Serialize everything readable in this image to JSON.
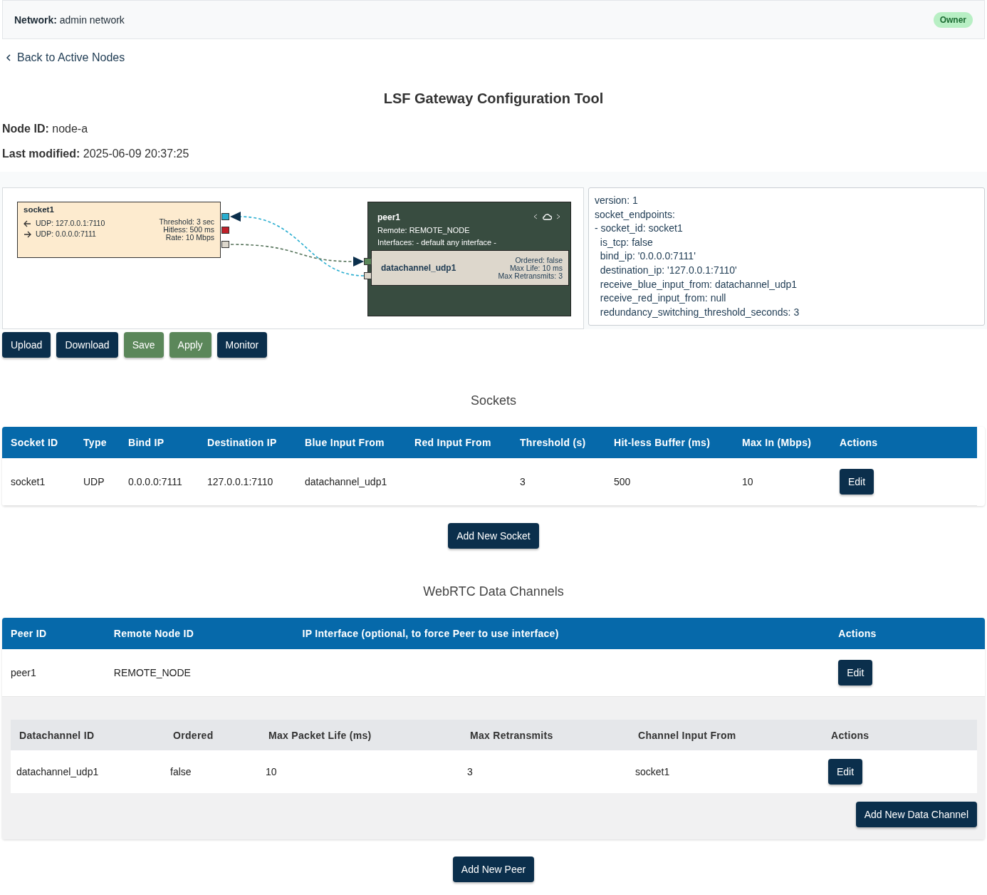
{
  "network": {
    "label": "Network:",
    "value": "admin network"
  },
  "role_badge": "Owner",
  "back_link": "Back to Active Nodes",
  "title": "LSF Gateway Configuration Tool",
  "node_id": {
    "label": "Node ID:",
    "value": "node-a"
  },
  "last_modified": {
    "label": "Last modified:",
    "value": "2025-06-09 20:37:25"
  },
  "diagram": {
    "socket": {
      "id": "socket1",
      "endpoints": [
        {
          "kind": "in",
          "text": "UDP: 127.0.0.1:7110"
        },
        {
          "kind": "out",
          "text": "UDP: 0.0.0.0:7111"
        }
      ],
      "stats": [
        "Threshold: 3 sec",
        "Hitless: 500 ms",
        "Rate: 10 Mbps"
      ]
    },
    "peer": {
      "id": "peer1",
      "remote": "Remote: REMOTE_NODE",
      "interfaces": "Interfaces: - default any interface -",
      "channel": {
        "id": "datachannel_udp1",
        "stats": [
          "Ordered: false",
          "Max Life: 10 ms",
          "Max Retransmits: 3"
        ]
      }
    }
  },
  "yaml_lines": [
    "version: 1",
    "socket_endpoints:",
    "- socket_id: socket1",
    "  is_tcp: false",
    "  bind_ip: '0.0.0.0:7111'",
    "  destination_ip: '127.0.0.1:7110'",
    "  receive_blue_input_from: datachannel_udp1",
    "  receive_red_input_from: null",
    "  redundancy_switching_threshold_seconds: 3"
  ],
  "toolbar": [
    {
      "label": "Upload",
      "kind": "primary"
    },
    {
      "label": "Download",
      "kind": "primary"
    },
    {
      "label": "Save",
      "kind": "success"
    },
    {
      "label": "Apply",
      "kind": "success"
    },
    {
      "label": "Monitor",
      "kind": "primary"
    }
  ],
  "sockets": {
    "heading": "Sockets",
    "columns": [
      "Socket ID",
      "Type",
      "Bind IP",
      "Destination IP",
      "Blue Input From",
      "Red Input From",
      "Threshold (s)",
      "Hit-less Buffer (ms)",
      "Max In (Mbps)",
      "Actions"
    ],
    "rows": [
      {
        "cells": [
          "socket1",
          "UDP",
          "0.0.0.0:7111",
          "127.0.0.1:7110",
          "datachannel_udp1",
          null,
          "3",
          "500",
          "10"
        ],
        "action": "Edit"
      }
    ],
    "add_button": "Add New Socket"
  },
  "webrtc": {
    "heading": "WebRTC Data Channels",
    "columns": [
      "Peer ID",
      "Remote Node ID",
      "IP Interface (optional, to force Peer to use interface)",
      "Actions"
    ],
    "rows": [
      {
        "cells": [
          "peer1",
          "REMOTE_NODE",
          null
        ],
        "action": "Edit",
        "datachannels": {
          "columns": [
            "Datachannel ID",
            "Ordered",
            "Max Packet Life (ms)",
            "Max Retransmits",
            "Channel Input From",
            "Actions"
          ],
          "rows": [
            {
              "cells": [
                "datachannel_udp1",
                "false",
                "10",
                "3",
                "socket1"
              ],
              "action": "Edit"
            }
          ],
          "add_button": "Add New Data Channel"
        }
      }
    ],
    "add_button": "Add New Peer"
  }
}
